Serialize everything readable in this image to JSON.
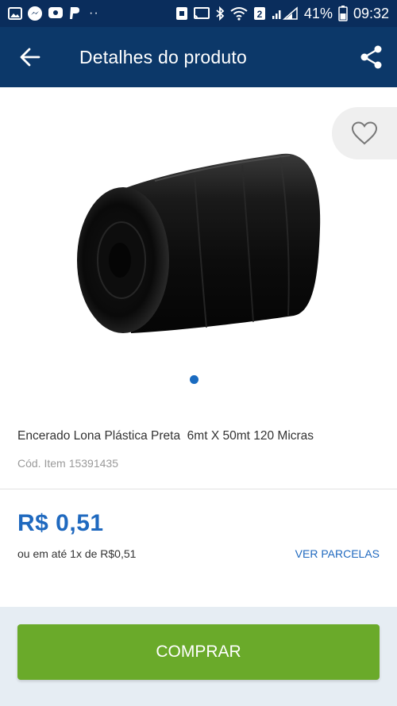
{
  "status_bar": {
    "battery_percent": "41%",
    "time": "09:32",
    "notification_dots": "··",
    "sim_badge": "2"
  },
  "app_bar": {
    "title": "Detalhes do produto"
  },
  "gallery": {
    "current_image": 1
  },
  "product": {
    "name": "Encerado Lona Plástica Preta  6mt X 50mt 120 Micras",
    "code_label": "Cód. Item",
    "code_value": "15391435"
  },
  "pricing": {
    "price": "R$ 0,51",
    "installments": "ou em até 1x de R$0,51",
    "see_installments": "VER PARCELAS"
  },
  "actions": {
    "buy_label": "COMPRAR"
  },
  "colors": {
    "status_bar": "#0a2d5c",
    "app_bar": "#0c3869",
    "price": "#1f69bf",
    "buy_button": "#6aaa2a"
  }
}
